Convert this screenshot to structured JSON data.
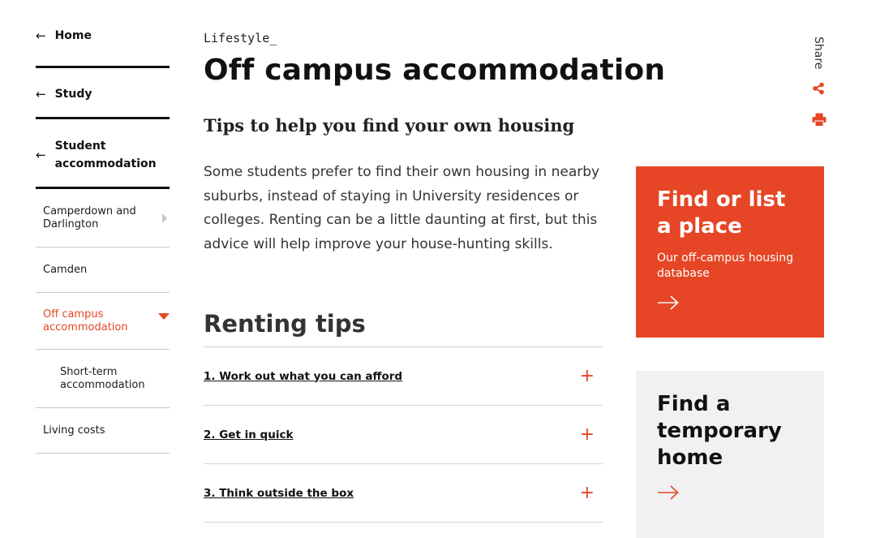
{
  "sidebar": {
    "top_items": [
      {
        "arrow": "←",
        "label": "Home"
      },
      {
        "arrow": "←",
        "label": "Study"
      },
      {
        "arrow": "←",
        "label": "Student accommodation"
      }
    ],
    "sub_items": [
      {
        "label": "Camperdown and Darlington"
      },
      {
        "label": "Camden"
      },
      {
        "label": "Off campus accommodation"
      },
      {
        "label": "Short-term accommodation"
      },
      {
        "label": "Living costs"
      }
    ]
  },
  "page": {
    "eyebrow": "Lifestyle_",
    "title": "Off campus accommodation",
    "subtitle": "Tips to help you find your own housing",
    "intro": "Some students prefer to find their own housing in nearby suburbs, instead of staying in University residences or colleges. Renting can be a little daunting at first, but this advice will help improve your house-hunting skills.",
    "section_heading": "Renting tips"
  },
  "accordion": [
    {
      "label": "1. Work out what you can afford",
      "icon": "+"
    },
    {
      "label": "2. Get in quick",
      "icon": "+"
    },
    {
      "label": "3. Think outside the box",
      "icon": "+"
    }
  ],
  "share": {
    "label": "Share",
    "share_icon": "share-icon",
    "print_icon": "print-icon"
  },
  "cards": {
    "find_list": {
      "title": "Find or list a place",
      "subtitle": "Our off-campus housing database"
    },
    "temporary": {
      "title": "Find a temporary home"
    }
  },
  "colors": {
    "accent": "#e64626",
    "card_grey": "#f1f1f1",
    "text": "#111111"
  }
}
